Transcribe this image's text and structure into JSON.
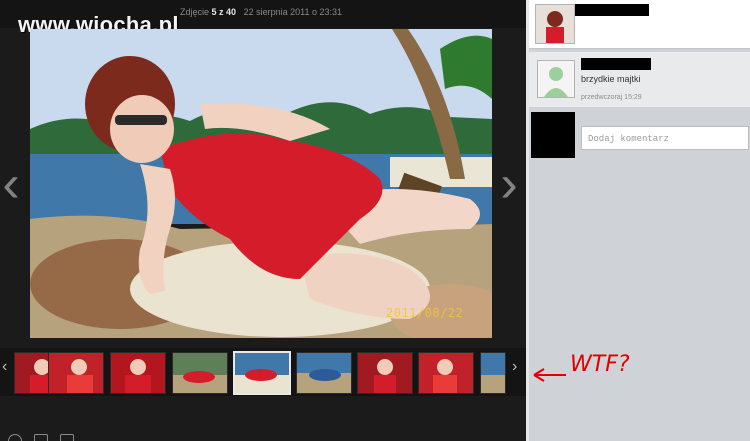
{
  "viewer": {
    "logo": "www.wiocha.pl",
    "counter_prefix": "Zdjęcie",
    "counter_current": "5 z 40",
    "counter_date": "22 sierpnia 2011 o 23:31",
    "prev_arrow": "‹",
    "next_arrow": "›",
    "photo_datestamp": "2011/08/22",
    "thumb_prev": "‹",
    "thumb_next": "›",
    "selected_thumb": 5,
    "thumbnail_count": 9
  },
  "panel": {
    "comment_text": "brzydkie majtki",
    "comment_time": "przedwczoraj 15:29",
    "add_comment_placeholder": "Dodaj komentarz"
  },
  "annotation": {
    "text": "WTF?",
    "color": "#e00000"
  },
  "colors": {
    "viewer_bg": "#1b1b1b",
    "panel_bg": "#cfd2d6",
    "dress": "#d41c2a"
  }
}
